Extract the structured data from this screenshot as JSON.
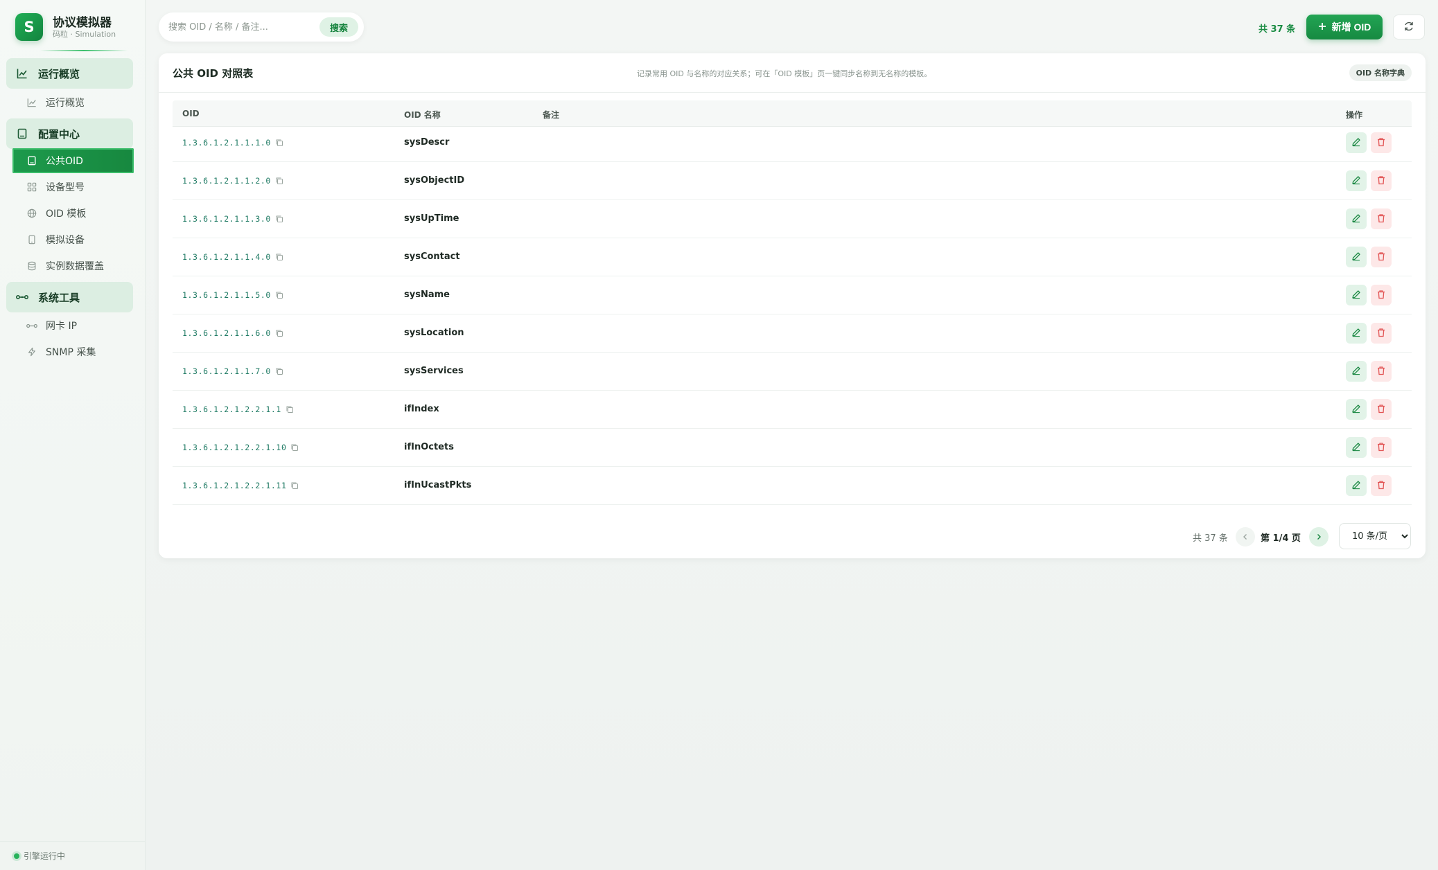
{
  "brand": {
    "logo_letter": "S",
    "title": "协议模拟器",
    "subtitle": "码粒 · Simulation"
  },
  "sidebar": {
    "groups": [
      {
        "label": "运行概览",
        "icon": "line-chart-icon"
      },
      {
        "label": "配置中心",
        "icon": "book-icon"
      },
      {
        "label": "系统工具",
        "icon": "network-icon"
      }
    ],
    "items": [
      {
        "label": "运行概览",
        "icon": "line-chart-icon"
      },
      {
        "label": "公共OID",
        "icon": "book-icon",
        "active": true
      },
      {
        "label": "设备型号",
        "icon": "grid-icon"
      },
      {
        "label": "OID 模板",
        "icon": "globe-icon"
      },
      {
        "label": "模拟设备",
        "icon": "device-icon"
      },
      {
        "label": "实例数据覆盖",
        "icon": "database-icon"
      },
      {
        "label": "网卡 IP",
        "icon": "network-icon"
      },
      {
        "label": "SNMP 采集",
        "icon": "lightning-icon"
      }
    ],
    "footer_status": "引擎运行中"
  },
  "search": {
    "placeholder": "搜索 OID / 名称 / 备注...",
    "button_label": "搜索"
  },
  "header": {
    "total_label": "共 37 条",
    "add_button_label": "新增 OID",
    "refresh_icon": "refresh-icon"
  },
  "card": {
    "title": "公共 OID 对照表",
    "description": "记录常用 OID 与名称的对应关系；可在「OID 模板」页一键同步名称到无名称的模板。",
    "badge": "OID 名称字典"
  },
  "table": {
    "columns": [
      "OID",
      "OID 名称",
      "备注",
      "操作"
    ],
    "rows": [
      {
        "oid": "1.3.6.1.2.1.1.1.0",
        "name": "sysDescr",
        "note": ""
      },
      {
        "oid": "1.3.6.1.2.1.1.2.0",
        "name": "sysObjectID",
        "note": ""
      },
      {
        "oid": "1.3.6.1.2.1.1.3.0",
        "name": "sysUpTime",
        "note": ""
      },
      {
        "oid": "1.3.6.1.2.1.1.4.0",
        "name": "sysContact",
        "note": ""
      },
      {
        "oid": "1.3.6.1.2.1.1.5.0",
        "name": "sysName",
        "note": ""
      },
      {
        "oid": "1.3.6.1.2.1.1.6.0",
        "name": "sysLocation",
        "note": ""
      },
      {
        "oid": "1.3.6.1.2.1.1.7.0",
        "name": "sysServices",
        "note": ""
      },
      {
        "oid": "1.3.6.1.2.1.2.2.1.1",
        "name": "ifIndex",
        "note": ""
      },
      {
        "oid": "1.3.6.1.2.1.2.2.1.10",
        "name": "ifInOctets",
        "note": ""
      },
      {
        "oid": "1.3.6.1.2.1.2.2.1.11",
        "name": "ifInUcastPkts",
        "note": ""
      }
    ]
  },
  "pagination": {
    "total": "共 37 条",
    "page_info": "第 1/4 页",
    "page_size": "10 条/页",
    "page_size_options": [
      "10 条/页"
    ]
  },
  "colors": {
    "accent": "#1d9a4c",
    "danger": "#e25555",
    "oid_text": "#1e7a63"
  }
}
